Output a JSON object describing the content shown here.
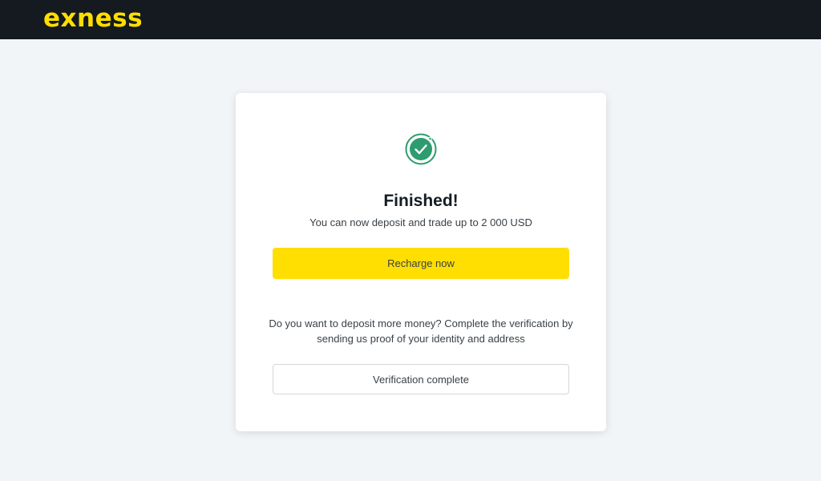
{
  "header": {
    "logo_text": "exness",
    "logo_color": "#ffde02",
    "background_color": "#141a20"
  },
  "dialog": {
    "icon": "check-circle-icon",
    "icon_color": "#2d9c6e",
    "title": "Finished!",
    "subtitle": "You can now deposit and trade up to 2 000 USD",
    "primary_button_label": "Recharge now",
    "primary_button_color": "#ffde02",
    "info_text": "Do you want to deposit more money? Complete the verification by sending us proof of your identity and address",
    "secondary_button_label": "Verification complete"
  }
}
